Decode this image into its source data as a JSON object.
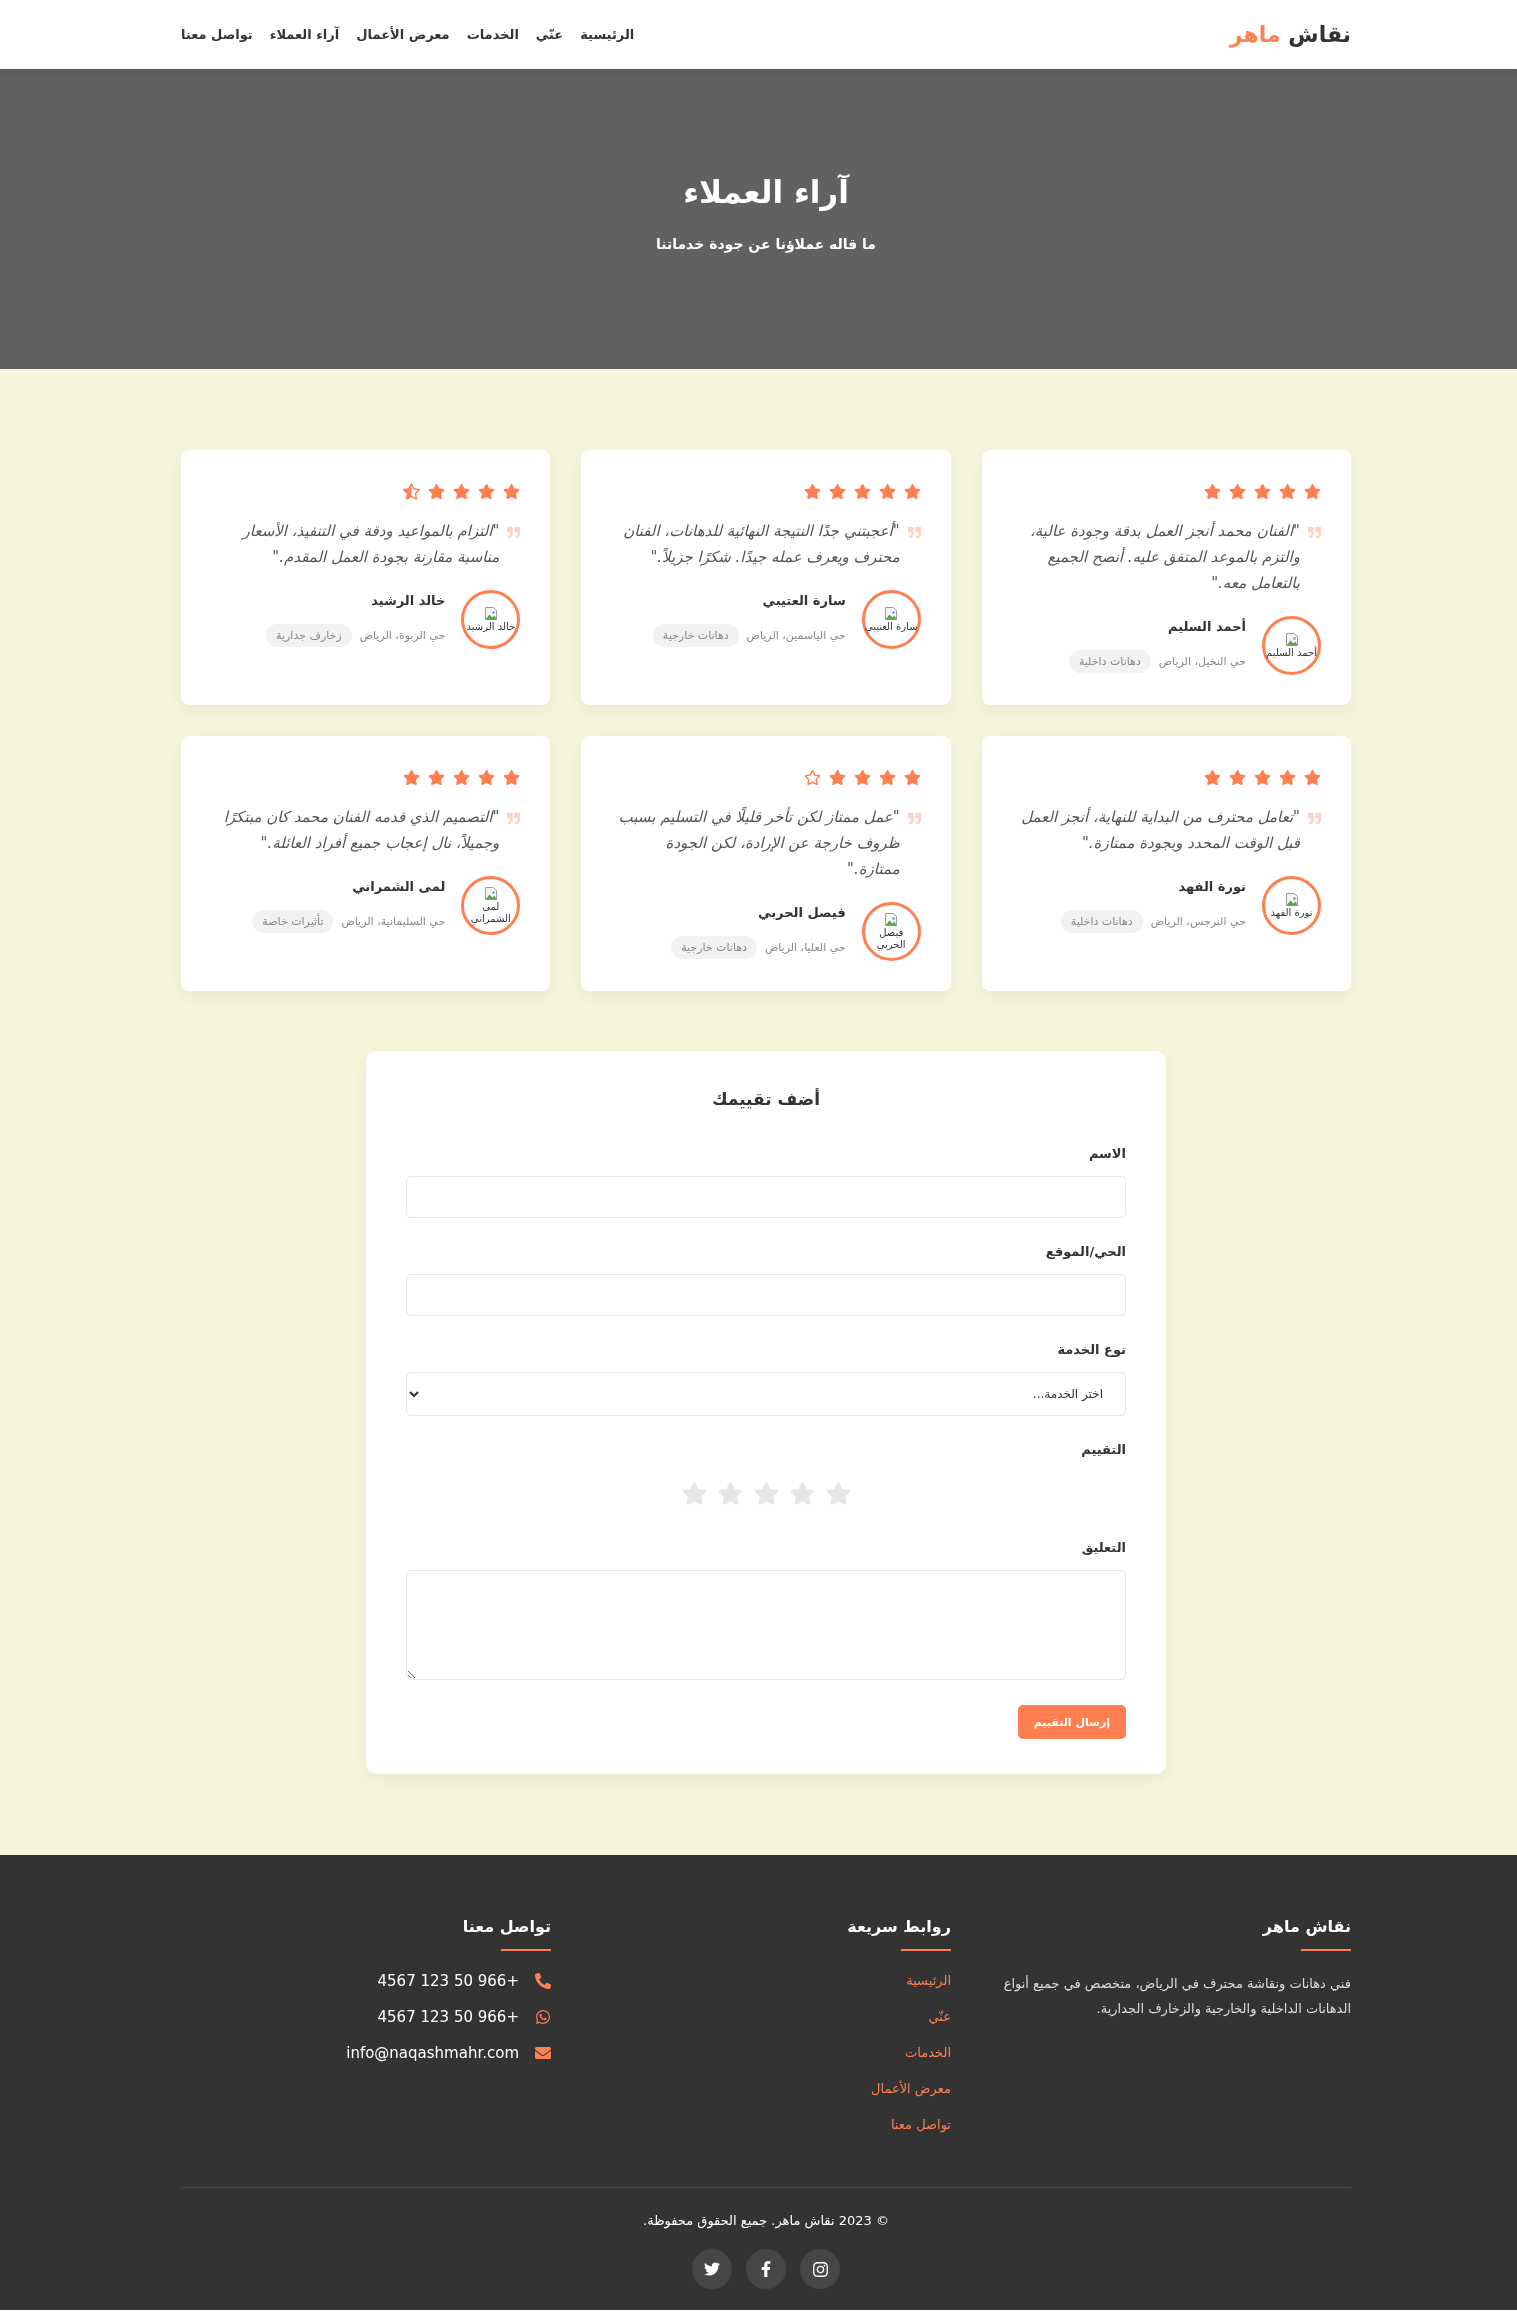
{
  "nav": {
    "logo": {
      "text": "نقاش",
      "accent": "ماهر"
    },
    "links": [
      {
        "label": "الرئيسية",
        "selected": false
      },
      {
        "label": "عنّي",
        "selected": false
      },
      {
        "label": "الخدمات",
        "selected": false
      },
      {
        "label": "معرض الأعمال",
        "selected": false
      },
      {
        "label": "آراء العملاء",
        "selected": false
      },
      {
        "label": "تواصل معنا",
        "selected": false
      }
    ]
  },
  "hero": {
    "title": "آراء العملاء",
    "subtitle": "ما قاله عملاؤنا عن جودة خدماتنا"
  },
  "testimonials": [
    {
      "stars": 5,
      "quote": "\"الفنان محمد أنجز العمل بدقة وجودة عالية، والتزم بالموعد المتفق عليه. أنصح الجميع بالتعامل معه.\"",
      "avatar_alt": "أحمد السليم",
      "name": "أحمد السليم",
      "location": "حي النخيل، الرياض",
      "service": "دهانات داخلية"
    },
    {
      "stars": 5,
      "quote": "\"أعجبتني جدًا النتيجة النهائية للدهانات، الفنان محترف ويعرف عمله جيدًا. شكرًا جزيلاً.\"",
      "avatar_alt": "سارة العتيبي",
      "name": "سارة العتيبي",
      "location": "حي الياسمين، الرياض",
      "service": "دهانات خارجية"
    },
    {
      "stars": 4.5,
      "quote": "\"التزام بالمواعيد ودقة في التنفيذ، الأسعار مناسبة مقارنة بجودة العمل المقدم.\"",
      "avatar_alt": "خالد الرشيد",
      "name": "خالد الرشيد",
      "location": "حي الربوة، الرياض",
      "service": "زخارف جدارية"
    },
    {
      "stars": 5,
      "quote": "\"تعامل محترف من البداية للنهاية، أنجز العمل قبل الوقت المحدد وبجودة ممتازة.\"",
      "avatar_alt": "نورة الفهد",
      "name": "نورة الفهد",
      "location": "حي النرجس، الرياض",
      "service": "دهانات داخلية"
    },
    {
      "stars": 4,
      "quote": "\"عمل ممتاز لكن تأخر قليلًا في التسليم بسبب ظروف خارجة عن الإرادة، لكن الجودة ممتازة.\"",
      "avatar_alt": "فيصل الحربي",
      "name": "فيصل الحربي",
      "location": "حي العليا، الرياض",
      "service": "دهانات خارجية"
    },
    {
      "stars": 5,
      "quote": "\"التصميم الذي قدمه الفنان محمد كان مبتكرًا وجميلاً، نال إعجاب جميع أفراد العائلة.\"",
      "avatar_alt": "لمى الشمراني",
      "name": "لمى الشمراني",
      "location": "حي السليمانية، الرياض",
      "service": "تأثيرات خاصة"
    }
  ],
  "review_form": {
    "title": "أضف تقييمك",
    "fields": [
      {
        "kind": "text",
        "label": "الاسم"
      },
      {
        "kind": "text",
        "label": "الحي/الموقع"
      },
      {
        "kind": "select",
        "label": "نوع الخدمة",
        "value": "اختر الخدمة..."
      },
      {
        "kind": "rating",
        "label": "التقييم",
        "stars": 0
      },
      {
        "kind": "textarea",
        "label": "التعليق"
      }
    ],
    "submit": "إرسال التقييم"
  },
  "footer": {
    "columns": [
      {
        "kind": "about",
        "title": "نقاش ماهر",
        "text": "فني دهانات ونقاشة محترف في الرياض، متخصص في جميع أنواع الدهانات الداخلية والخارجية والزخارف الجدارية."
      },
      {
        "kind": "links",
        "title": "روابط سريعة",
        "links": [
          "الرئيسية",
          "عنّي",
          "الخدمات",
          "معرض الأعمال",
          "تواصل معنا"
        ]
      },
      {
        "kind": "contact",
        "title": "تواصل معنا",
        "items": [
          {
            "kind": "phone",
            "text": "+966 50 123 4567"
          },
          {
            "kind": "whatsapp",
            "text": "+966 50 123 4567"
          },
          {
            "kind": "email",
            "text": "info@naqashmahr.com"
          }
        ]
      }
    ],
    "copyright": "© 2023 نقاش ماهر. جميع الحقوق محفوظة."
  }
}
